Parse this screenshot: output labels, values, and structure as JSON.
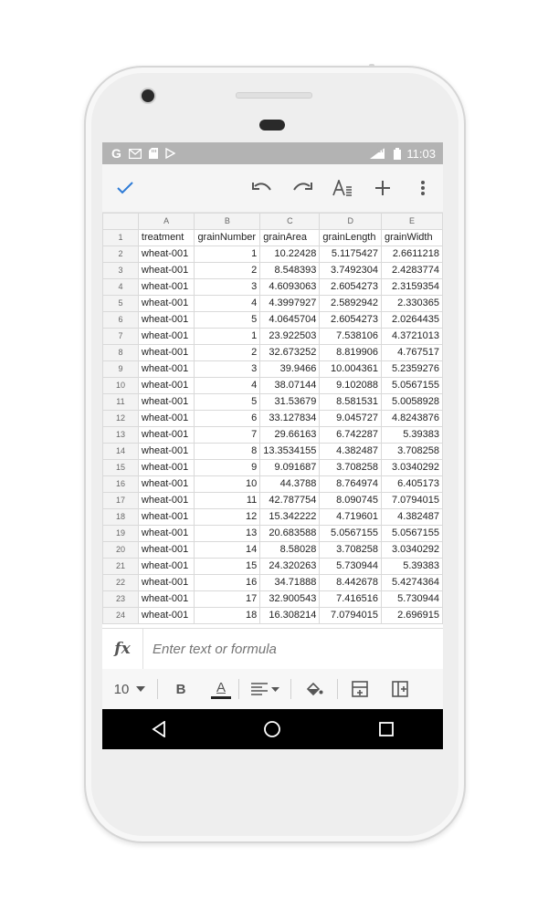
{
  "status_bar": {
    "left_icons": [
      "g-icon",
      "gmail-icon",
      "sd-card-icon",
      "play-store-icon"
    ],
    "network": "LTE",
    "time": "11:03"
  },
  "toolbar": {
    "confirm": "check-icon",
    "actions": [
      "undo-icon",
      "redo-icon",
      "text-format-icon",
      "add-icon",
      "more-vert-icon"
    ]
  },
  "sheet": {
    "columns": [
      "A",
      "B",
      "C",
      "D",
      "E"
    ],
    "rows": [
      {
        "n": "1",
        "cells": [
          "treatment",
          "grainNumber",
          "grainArea",
          "grainLength",
          "grainWidth"
        ]
      },
      {
        "n": "2",
        "cells": [
          "wheat-001",
          "1",
          "10.22428",
          "5.1175427",
          "2.6611218"
        ]
      },
      {
        "n": "3",
        "cells": [
          "wheat-001",
          "2",
          "8.548393",
          "3.7492304",
          "2.4283774"
        ]
      },
      {
        "n": "4",
        "cells": [
          "wheat-001",
          "3",
          "4.6093063",
          "2.6054273",
          "2.3159354"
        ]
      },
      {
        "n": "5",
        "cells": [
          "wheat-001",
          "4",
          "4.3997927",
          "2.5892942",
          "2.330365"
        ]
      },
      {
        "n": "6",
        "cells": [
          "wheat-001",
          "5",
          "4.0645704",
          "2.6054273",
          "2.0264435"
        ]
      },
      {
        "n": "7",
        "cells": [
          "wheat-001",
          "1",
          "23.922503",
          "7.538106",
          "4.3721013"
        ]
      },
      {
        "n": "8",
        "cells": [
          "wheat-001",
          "2",
          "32.673252",
          "8.819906",
          "4.767517"
        ]
      },
      {
        "n": "9",
        "cells": [
          "wheat-001",
          "3",
          "39.9466",
          "10.004361",
          "5.2359276"
        ]
      },
      {
        "n": "10",
        "cells": [
          "wheat-001",
          "4",
          "38.07144",
          "9.102088",
          "5.0567155"
        ]
      },
      {
        "n": "11",
        "cells": [
          "wheat-001",
          "5",
          "31.53679",
          "8.581531",
          "5.0058928"
        ]
      },
      {
        "n": "12",
        "cells": [
          "wheat-001",
          "6",
          "33.127834",
          "9.045727",
          "4.8243876"
        ]
      },
      {
        "n": "13",
        "cells": [
          "wheat-001",
          "7",
          "29.66163",
          "6.742287",
          "5.39383"
        ]
      },
      {
        "n": "14",
        "cells": [
          "wheat-001",
          "8",
          "13.3534155",
          "4.382487",
          "3.708258"
        ]
      },
      {
        "n": "15",
        "cells": [
          "wheat-001",
          "9",
          "9.091687",
          "3.708258",
          "3.0340292"
        ]
      },
      {
        "n": "16",
        "cells": [
          "wheat-001",
          "10",
          "44.3788",
          "8.764974",
          "6.405173"
        ]
      },
      {
        "n": "17",
        "cells": [
          "wheat-001",
          "11",
          "42.787754",
          "8.090745",
          "7.0794015"
        ]
      },
      {
        "n": "18",
        "cells": [
          "wheat-001",
          "12",
          "15.342222",
          "4.719601",
          "4.382487"
        ]
      },
      {
        "n": "19",
        "cells": [
          "wheat-001",
          "13",
          "20.683588",
          "5.0567155",
          "5.0567155"
        ]
      },
      {
        "n": "20",
        "cells": [
          "wheat-001",
          "14",
          "8.58028",
          "3.708258",
          "3.0340292"
        ]
      },
      {
        "n": "21",
        "cells": [
          "wheat-001",
          "15",
          "24.320263",
          "5.730944",
          "5.39383"
        ]
      },
      {
        "n": "22",
        "cells": [
          "wheat-001",
          "16",
          "34.71888",
          "8.442678",
          "5.4274364"
        ]
      },
      {
        "n": "23",
        "cells": [
          "wheat-001",
          "17",
          "32.900543",
          "7.416516",
          "5.730944"
        ]
      },
      {
        "n": "24",
        "cells": [
          "wheat-001",
          "18",
          "16.308214",
          "7.0794015",
          "2.696915"
        ]
      }
    ]
  },
  "formula_bar": {
    "label": "fx",
    "placeholder": "Enter text or formula"
  },
  "format_bar": {
    "font_size": "10",
    "bold": "B",
    "text_color": "A"
  },
  "colors": {
    "accent": "#2e7bd6",
    "status_bar": "#b3b3b3",
    "text_color_underline": "#222222"
  }
}
